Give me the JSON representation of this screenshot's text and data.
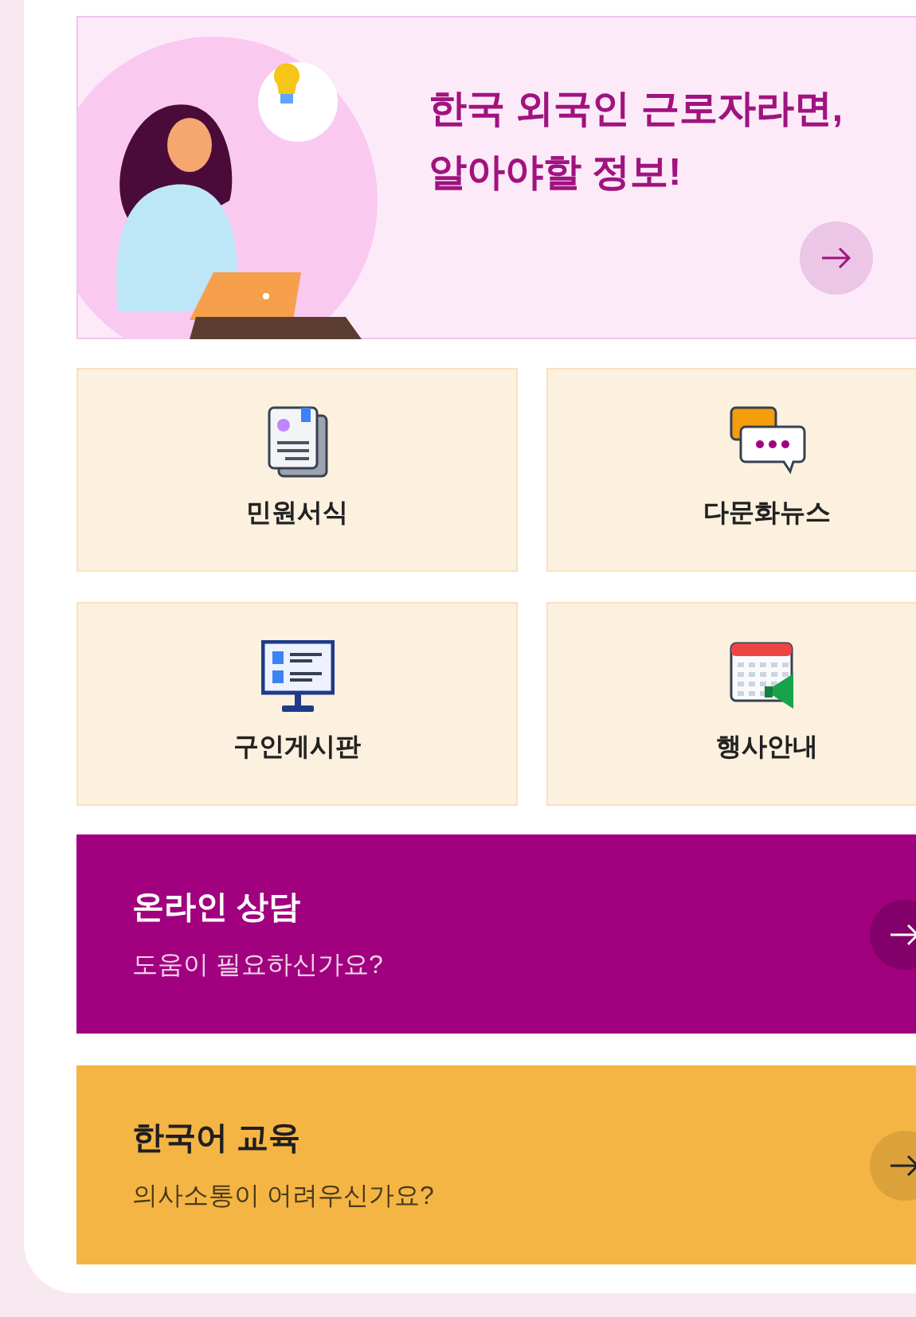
{
  "banner": {
    "title_lines": [
      "한국 외국인 근로자라면,",
      "알아야할 정보!"
    ]
  },
  "tiles": [
    {
      "label": "민원서식",
      "kind": "documents"
    },
    {
      "label": "다문화뉴스",
      "kind": "chat"
    },
    {
      "label": "구인게시판",
      "kind": "board"
    },
    {
      "label": "행사안내",
      "kind": "event"
    }
  ],
  "cards": [
    {
      "title": "온라인 상담",
      "subtitle": "도움이 필요하신가요?",
      "kind": "purple"
    },
    {
      "title": "한국어 교육",
      "subtitle": "의사소통이 어려우신가요?",
      "kind": "yellow"
    }
  ]
}
